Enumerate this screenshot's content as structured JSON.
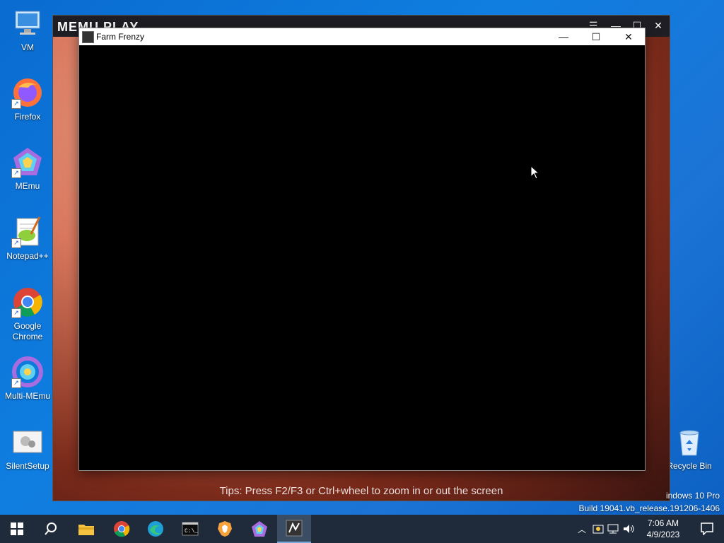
{
  "desktop_icons": [
    {
      "label": "VM",
      "icon": "monitor-icon"
    },
    {
      "label": "Firefox",
      "icon": "firefox-icon"
    },
    {
      "label": "MEmu",
      "icon": "memu-icon"
    },
    {
      "label": "Notepad++",
      "icon": "notepadpp-icon"
    },
    {
      "label": "Google Chrome",
      "icon": "chrome-icon"
    },
    {
      "label": "Multi-MEmu",
      "icon": "multi-memu-icon"
    },
    {
      "label": "SilentSetup",
      "icon": "setup-icon"
    },
    {
      "label": "Recycle Bin",
      "icon": "recycle-bin-icon"
    }
  ],
  "memu_window": {
    "brand": "MEMU PLAY",
    "tips": "Tips: Press F2/F3 or Ctrl+wheel to zoom in or out the screen"
  },
  "game_window": {
    "title": "Farm Frenzy",
    "minimize": "—",
    "maximize": "☐",
    "close": "✕"
  },
  "watermark": {
    "line1": "indows 10 Pro",
    "line2": "Build 19041.vb_release.191206-1406"
  },
  "taskbar": {
    "clock_time": "7:06 AM",
    "clock_date": "4/9/2023"
  },
  "colors": {
    "desktop": "#0f7ee0",
    "taskbar": "#1f2b3a",
    "memu_accent": "#a86be0"
  }
}
